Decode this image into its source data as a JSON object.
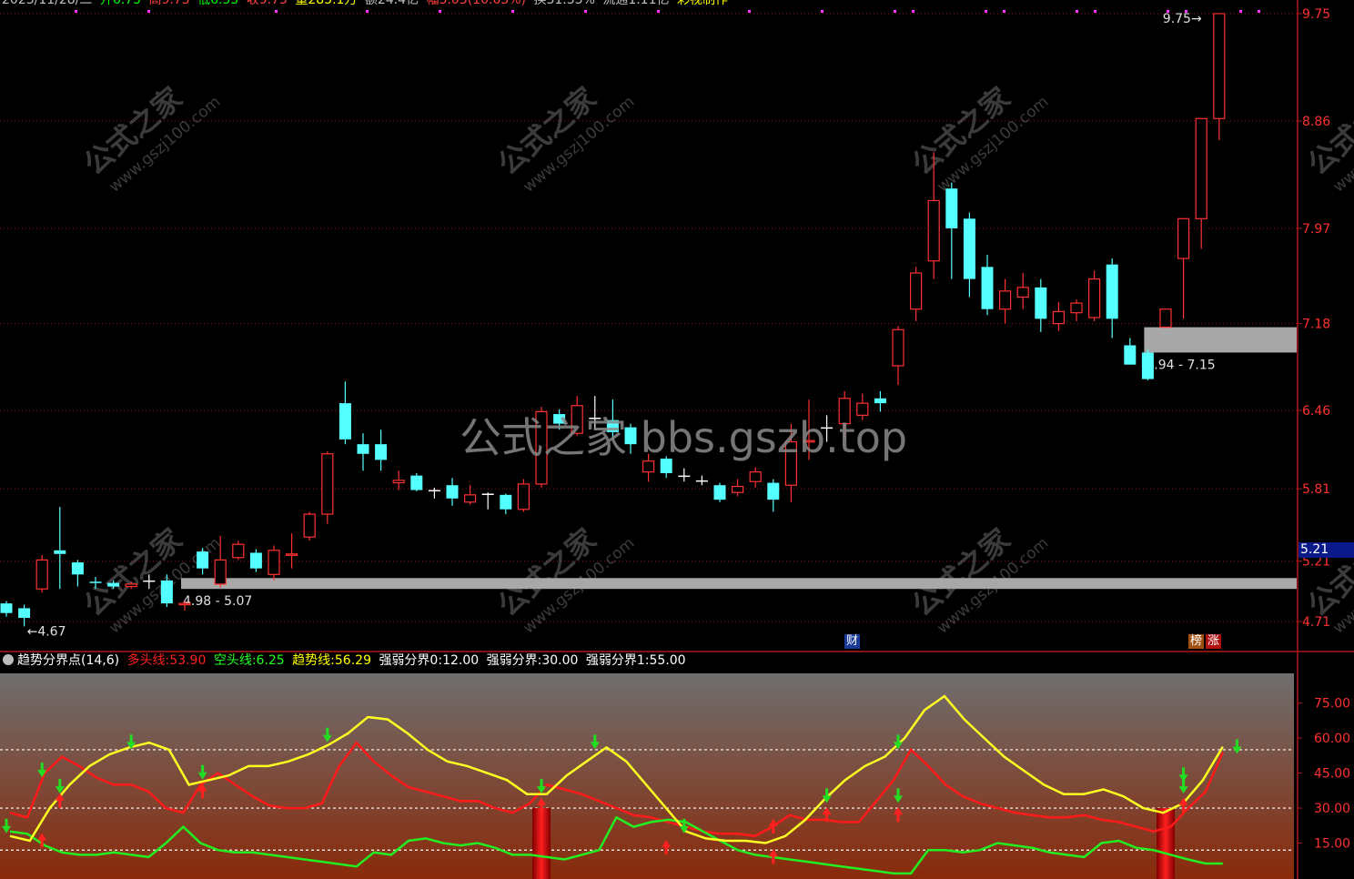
{
  "header": {
    "segments": [
      {
        "text": "2023/11/28/二",
        "color": "#c0c0c0"
      },
      {
        "text": "开6.75",
        "color": "#00ff00"
      },
      {
        "text": "高9.75",
        "color": "#ff4040"
      },
      {
        "text": "低6.55",
        "color": "#00ff00"
      },
      {
        "text": "收9.75",
        "color": "#ff4040"
      },
      {
        "text": "量285.1万",
        "color": "#ffff00"
      },
      {
        "text": "额24.4亿",
        "color": "#c0c0c0"
      },
      {
        "text": "幅3.03(10.05%)",
        "color": "#ff4040"
      },
      {
        "text": "换31.33%",
        "color": "#c0c0c0"
      },
      {
        "text": "流通1.11亿",
        "color": "#c0c0c0"
      },
      {
        "text": "彩视制作",
        "color": "#ffff00"
      }
    ]
  },
  "watermarks": {
    "center": "公式之家 bbs.gszb.top",
    "tile_main": "公式之家",
    "tile_sub": "www.gszj100.com"
  },
  "price_axis": {
    "labels": [
      "9.75",
      "8.86",
      "7.97",
      "7.18",
      "6.46",
      "5.81",
      "5.21",
      "4.71"
    ],
    "current_price": "5.21"
  },
  "zones": [
    {
      "label": "4.98 - 5.07",
      "low": 4.98,
      "high": 5.07,
      "start_index": 10
    },
    {
      "label": "6.94 - 7.15",
      "low": 6.94,
      "high": 7.15,
      "start_index": 64
    }
  ],
  "annotations": [
    {
      "label": "4.67",
      "kind": "low-marker"
    },
    {
      "label": "9.75",
      "kind": "high-marker"
    }
  ],
  "badges": [
    {
      "label": "财",
      "color": "#1a3a9a",
      "index": 46
    },
    {
      "label": "榜",
      "color": "#a05010",
      "index": 65
    },
    {
      "label": "涨",
      "color": "#b01010",
      "index": 66
    }
  ],
  "indicator": {
    "name": "趋势分界点(14,6)",
    "fields": [
      {
        "label": "多头线:",
        "value": "53.90",
        "color": "#ff2020"
      },
      {
        "label": "空头线:",
        "value": "6.25",
        "color": "#20ff20"
      },
      {
        "label": "趋势线:",
        "value": "56.29",
        "color": "#ffff00"
      },
      {
        "label": "强弱分界0:",
        "value": "12.00",
        "color": "#ffffff"
      },
      {
        "label": "强弱分界:",
        "value": "30.00",
        "color": "#ffffff"
      },
      {
        "label": "强弱分界1:",
        "value": "55.00",
        "color": "#ffffff"
      }
    ],
    "axis_labels": [
      "75.00",
      "60.00",
      "45.00",
      "30.00",
      "15.00"
    ]
  },
  "chart_data": [
    {
      "type": "candlestick",
      "title": "",
      "ylim": [
        4.6,
        9.8
      ],
      "series_colors": {
        "up": "#ff3030",
        "down": "#54ffff"
      },
      "candles": [
        [
          4.86,
          4.78,
          4.88,
          4.75
        ],
        [
          4.82,
          4.74,
          4.85,
          4.67
        ],
        [
          4.98,
          5.22,
          5.26,
          4.95
        ],
        [
          5.3,
          5.27,
          5.66,
          4.98
        ],
        [
          5.2,
          5.1,
          5.22,
          5.0
        ],
        [
          5.04,
          5.03,
          5.08,
          4.98
        ],
        [
          5.03,
          5.0,
          5.05,
          4.98
        ],
        [
          5.0,
          5.02,
          5.04,
          4.98
        ],
        [
          5.05,
          5.05,
          5.1,
          4.98
        ],
        [
          5.05,
          4.86,
          5.1,
          4.83
        ],
        [
          4.85,
          4.86,
          4.88,
          4.8
        ],
        [
          5.29,
          5.15,
          5.32,
          5.1
        ],
        [
          5.02,
          5.22,
          5.42,
          4.99
        ],
        [
          5.24,
          5.35,
          5.38,
          5.22
        ],
        [
          5.28,
          5.15,
          5.31,
          5.12
        ],
        [
          5.1,
          5.3,
          5.34,
          5.05
        ],
        [
          5.26,
          5.27,
          5.44,
          5.15
        ],
        [
          5.41,
          5.6,
          5.62,
          5.38
        ],
        [
          5.6,
          6.1,
          6.12,
          5.52
        ],
        [
          6.52,
          6.22,
          6.7,
          6.18
        ],
        [
          6.18,
          6.1,
          6.27,
          5.96
        ],
        [
          6.18,
          6.05,
          6.3,
          5.96
        ],
        [
          5.86,
          5.88,
          5.96,
          5.8
        ],
        [
          5.92,
          5.8,
          5.94,
          5.79
        ],
        [
          5.8,
          5.8,
          5.82,
          5.73
        ],
        [
          5.84,
          5.73,
          5.9,
          5.67
        ],
        [
          5.7,
          5.76,
          5.84,
          5.68
        ],
        [
          5.77,
          5.77,
          5.78,
          5.64
        ],
        [
          5.76,
          5.64,
          5.77,
          5.6
        ],
        [
          5.64,
          5.85,
          5.89,
          5.62
        ],
        [
          5.85,
          6.45,
          6.49,
          5.82
        ],
        [
          6.43,
          6.35,
          6.47,
          6.3
        ],
        [
          6.27,
          6.5,
          6.58,
          6.25
        ],
        [
          6.4,
          6.4,
          6.58,
          6.3
        ],
        [
          6.38,
          6.28,
          6.55,
          6.22
        ],
        [
          6.32,
          6.18,
          6.35,
          6.1
        ],
        [
          5.95,
          6.04,
          6.1,
          5.87
        ],
        [
          6.06,
          5.94,
          6.08,
          5.9
        ],
        [
          5.92,
          5.92,
          5.98,
          5.87
        ],
        [
          5.88,
          5.88,
          5.92,
          5.84
        ],
        [
          5.84,
          5.72,
          5.86,
          5.7
        ],
        [
          5.78,
          5.83,
          5.89,
          5.75
        ],
        [
          5.87,
          5.95,
          5.99,
          5.82
        ],
        [
          5.86,
          5.72,
          5.89,
          5.62
        ],
        [
          5.84,
          6.2,
          6.35,
          5.7
        ],
        [
          6.2,
          6.21,
          6.55,
          6.05
        ],
        [
          6.32,
          6.32,
          6.42,
          6.2
        ],
        [
          6.35,
          6.56,
          6.62,
          6.22
        ],
        [
          6.42,
          6.52,
          6.6,
          6.38
        ],
        [
          6.56,
          6.52,
          6.62,
          6.45
        ],
        [
          6.83,
          7.13,
          7.16,
          6.67
        ],
        [
          7.3,
          7.6,
          7.65,
          7.2
        ],
        [
          7.7,
          8.2,
          8.6,
          7.55
        ],
        [
          8.3,
          7.97,
          8.35,
          7.55
        ],
        [
          8.05,
          7.55,
          8.1,
          7.4
        ],
        [
          7.65,
          7.3,
          7.75,
          7.25
        ],
        [
          7.3,
          7.45,
          7.55,
          7.18
        ],
        [
          7.4,
          7.48,
          7.6,
          7.3
        ],
        [
          7.48,
          7.22,
          7.55,
          7.11
        ],
        [
          7.18,
          7.28,
          7.36,
          7.12
        ],
        [
          7.27,
          7.35,
          7.38,
          7.2
        ],
        [
          7.23,
          7.55,
          7.62,
          7.2
        ],
        [
          7.67,
          7.22,
          7.72,
          7.06
        ],
        [
          7.0,
          6.84,
          7.06,
          6.84
        ],
        [
          6.94,
          6.72,
          6.97,
          6.71
        ],
        [
          7.15,
          7.3,
          7.3,
          7.15
        ],
        [
          7.72,
          8.05,
          8.05,
          7.22
        ],
        [
          8.05,
          8.88,
          8.88,
          7.8
        ],
        [
          8.88,
          9.75,
          9.75,
          8.7
        ]
      ]
    },
    {
      "type": "line",
      "title": "",
      "ylim": [
        0,
        85
      ],
      "reference_lines": [
        12,
        30,
        55
      ],
      "series": [
        {
          "name": "多头线",
          "color": "#ff1a1a",
          "values": [
            28,
            26,
            45,
            52,
            48,
            43,
            40,
            40,
            37,
            30,
            28,
            40,
            45,
            40,
            35,
            31,
            30,
            30,
            32,
            48,
            58,
            50,
            44,
            39,
            37,
            35,
            33,
            33,
            30,
            28,
            32,
            40,
            38,
            36,
            33,
            30,
            27,
            26,
            24,
            22,
            20,
            19,
            19,
            18,
            22,
            27,
            25,
            25,
            24,
            24,
            33,
            42,
            55,
            48,
            40,
            35,
            32,
            30,
            28,
            27,
            26,
            26,
            27,
            25,
            24,
            22,
            20,
            22,
            30,
            37,
            53.9
          ]
        },
        {
          "name": "空头线",
          "color": "#22ee22",
          "values": [
            20,
            19,
            14,
            11,
            10,
            10,
            11,
            10,
            9,
            15,
            22,
            15,
            12,
            11,
            11,
            10,
            9,
            8,
            7,
            6,
            5,
            11,
            10,
            16,
            17,
            15,
            14,
            15,
            13,
            10,
            10,
            9,
            8,
            10,
            12,
            26,
            22,
            24,
            25,
            24,
            20,
            16,
            12,
            10,
            9,
            8,
            7,
            6,
            5,
            4,
            3,
            2,
            2,
            12,
            12,
            11,
            12,
            15,
            14,
            13,
            11,
            10,
            9,
            15,
            16,
            13,
            12,
            10,
            8,
            6.25,
            6.25
          ]
        },
        {
          "name": "趋势线",
          "color": "#ffff22",
          "values": [
            18,
            16,
            30,
            40,
            48,
            53,
            56,
            58,
            55,
            40,
            42,
            44,
            48,
            48,
            50,
            53,
            57,
            62,
            69,
            68,
            62,
            55,
            50,
            48,
            45,
            42,
            36,
            36,
            44,
            50,
            56,
            50,
            40,
            30,
            20,
            17,
            16,
            16,
            15,
            18,
            25,
            34,
            42,
            48,
            52,
            60,
            72,
            78,
            68,
            60,
            52,
            46,
            40,
            36,
            36,
            38,
            35,
            30,
            28,
            32,
            42,
            56.29
          ]
        }
      ]
    }
  ]
}
